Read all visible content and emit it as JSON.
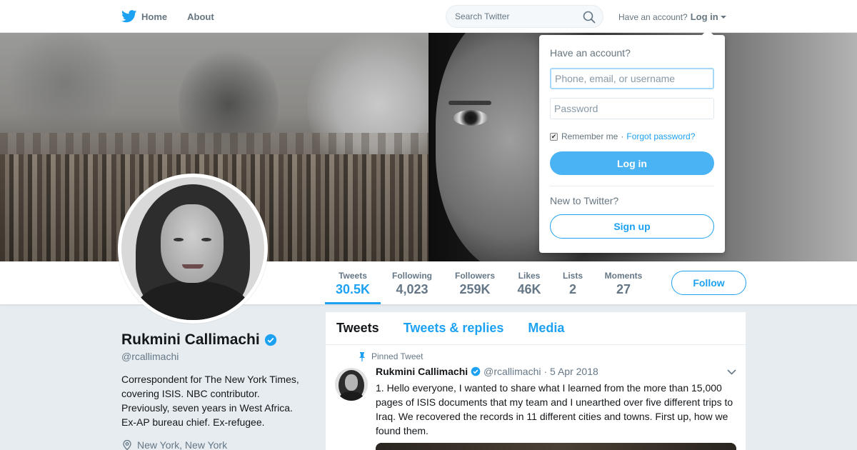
{
  "nav": {
    "home_label": "Home",
    "about_label": "About",
    "search_placeholder": "Search Twitter",
    "have_account_text": "Have an account?",
    "login_label": "Log in"
  },
  "login_dropdown": {
    "title": "Have an account?",
    "username_placeholder": "Phone, email, or username",
    "password_placeholder": "Password",
    "remember_label": "Remember me",
    "separator": "·",
    "forgot_label": "Forgot password?",
    "login_button": "Log in",
    "new_text": "New to Twitter?",
    "signup_button": "Sign up"
  },
  "stats": [
    {
      "label": "Tweets",
      "value": "30.5K"
    },
    {
      "label": "Following",
      "value": "4,023"
    },
    {
      "label": "Followers",
      "value": "259K"
    },
    {
      "label": "Likes",
      "value": "46K"
    },
    {
      "label": "Lists",
      "value": "2"
    },
    {
      "label": "Moments",
      "value": "27"
    }
  ],
  "follow_button": "Follow",
  "profile": {
    "name": "Rukmini Callimachi",
    "handle": "@rcallimachi",
    "bio": "Correspondent for The New York Times, covering ISIS. NBC contributor. Previously, seven years in West Africa. Ex-AP bureau chief. Ex-refugee.",
    "location": "New York, New York"
  },
  "timeline": {
    "tabs": [
      "Tweets",
      "Tweets & replies",
      "Media"
    ],
    "pinned_label": "Pinned Tweet",
    "tweet": {
      "name": "Rukmini Callimachi",
      "handle": "@rcallimachi",
      "date": "· 5 Apr 2018",
      "text": "1. Hello everyone, I wanted to share what I learned from the more than 15,000 pages of ISIS documents that my team and I unearthed over five different trips to Iraq. We recovered the records in 11 different cities and towns. First up, how we found them."
    }
  },
  "colors": {
    "accent": "#1da1f2",
    "login_button": "#4ab3f4",
    "background": "#e6ecf0"
  }
}
